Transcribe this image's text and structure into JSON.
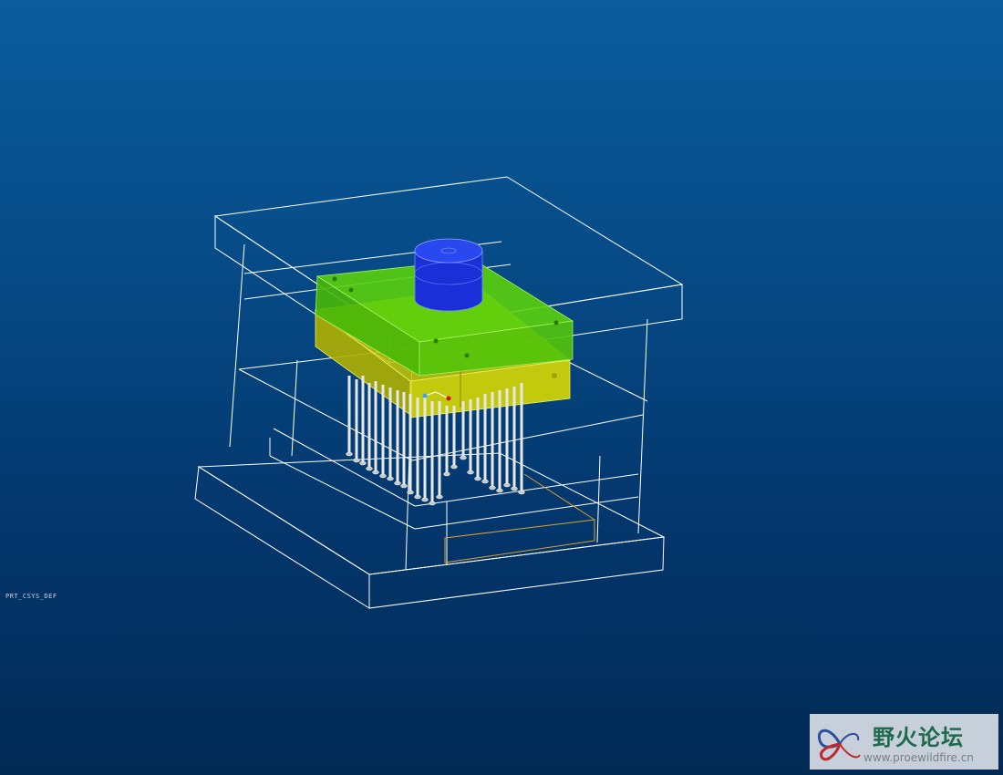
{
  "viewport": {
    "background_top": "#0a5c9c",
    "background_bottom": "#022a55",
    "wireframe_color": "#ffffff",
    "cavity_plate_color": "#4fd10a",
    "core_plate_color": "#d8d800",
    "sprue_bushing_color": "#1428d8",
    "ejector_pin_color": "#e8e8e8",
    "ejector_plate_outline_color": "#d9a030"
  },
  "csys_label": "PRT_CSYS_DEF",
  "watermark": {
    "title": "野火论坛",
    "url": "www.proewildfire.cn",
    "logo_icon": "butterfly-logo"
  }
}
